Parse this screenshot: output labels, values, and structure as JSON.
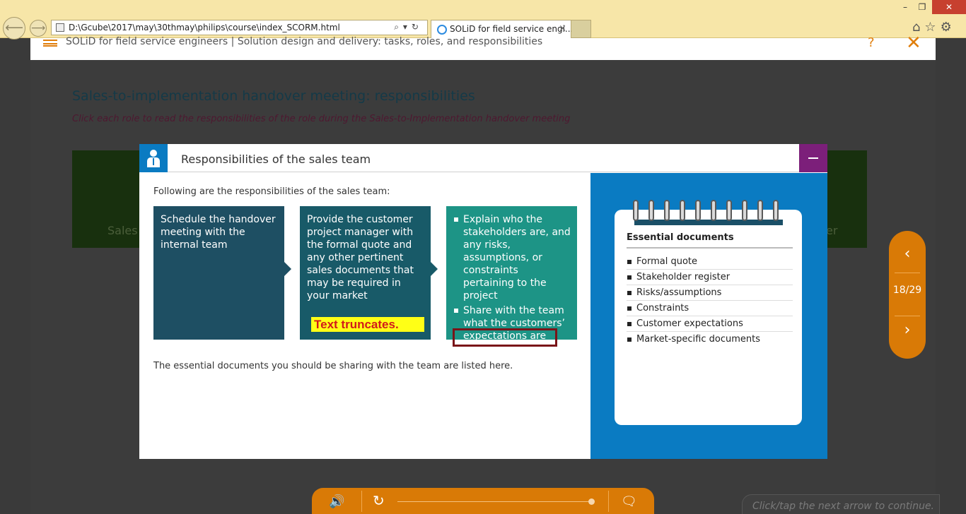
{
  "browser": {
    "address": "D:\\Gcube\\2017\\may\\30thmay\\philips\\course\\index_SCORM.html",
    "tab_title": "SOLiD for field service engi...",
    "tab_close": "×",
    "win_min": "–",
    "win_max": "❐",
    "win_close": "✕",
    "right_icons": "⌂☆⚙"
  },
  "course": {
    "title": "SOLiD for field service engineers | Solution design and delivery: tasks, roles, and responsibilities",
    "help": "?",
    "close": "✕"
  },
  "slide": {
    "title": "Sales-to-implementation handover meeting: responsibilities",
    "subtitle": "Click each role to read the responsibilities of the role during the Sales-to-Implementation handover meeting",
    "role_left_partial": "Sales",
    "role_right_partial": "er"
  },
  "modal": {
    "title": "Responsibilities of the sales team",
    "intro": "Following are the responsibilities of the sales team:",
    "cards": [
      "Schedule the handover meeting with the internal team",
      "Provide the customer project manager with the formal quote and any other pertinent sales documents that may be required in your market"
    ],
    "card3_items": [
      "Explain who the stakeholders are, and any risks, assumptions, or constraints pertaining to the project",
      "Share with the team what the customers’ expectations are"
    ],
    "annotation": "Text truncates.",
    "outro": "The essential documents you should be sharing with the team are listed here.",
    "notepad": {
      "title": "Essential documents",
      "items": [
        "Formal quote",
        "Stakeholder register",
        "Risks/assumptions",
        "Constraints",
        "Customer expectations",
        "Market-specific documents"
      ]
    }
  },
  "nav": {
    "prev": "‹",
    "next": "›",
    "counter": "18/29"
  },
  "toolbar": {
    "audio": "🔊",
    "replay": "↻",
    "transcript": "🗨"
  },
  "hint": "Click/tap the next arrow to continue.",
  "colors": {
    "accent": "#d97a06",
    "modal_blue": "#0a7bc2",
    "minimize_purple": "#7c1f7a",
    "card1": "#1e4f63",
    "card2": "#185a68",
    "card3": "#1d9486"
  }
}
